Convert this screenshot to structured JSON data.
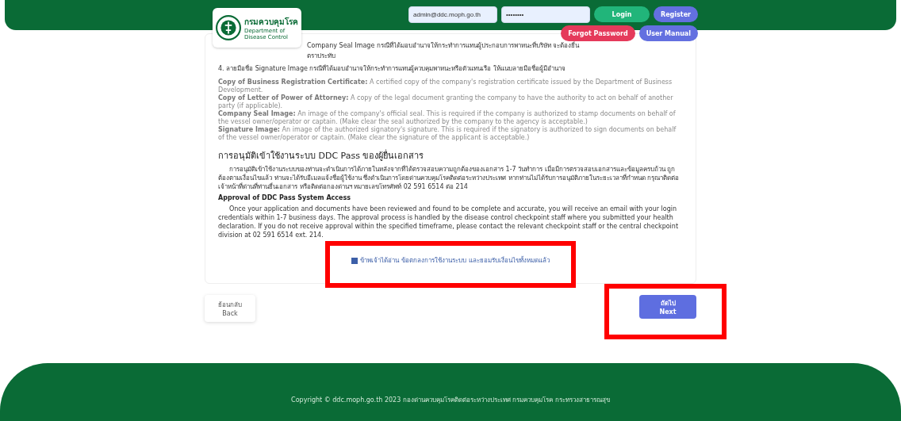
{
  "header": {
    "logo_title": "กรมควบคุมโรค",
    "logo_subtitle": "Department of Disease Control",
    "email": {
      "value": "admin@ddc.moph.go.th"
    },
    "password": {
      "value": "••••••••"
    },
    "buttons": [
      {
        "kind": "login",
        "label": "Login"
      },
      {
        "kind": "register",
        "label": "Register"
      },
      {
        "kind": "forgot",
        "label": "Forgot Password"
      },
      {
        "kind": "manual",
        "label": "User Manual"
      }
    ]
  },
  "documents": {
    "lines": [
      "Company Seal Image กรณีที่ได้มอบอำนาจให้กระทำการแทนผู้ประกอบการพาหนะที่บริษัท จะต้องยื่นตราประทับ",
      "4. ลายมือชื่อ Signature Image กรณีที่ได้มอบอำนาจให้กระทำการแทนผู้ควบคุมพาหนะหรือตัวแทนเรือ ให้แนบลายมือชื่อผู้มีอำนาจ"
    ],
    "definitions": [
      {
        "term": "Copy of Business Registration Certificate:",
        "text": "A certified copy of the company's registration certificate issued by the Department of Business Development."
      },
      {
        "term": "Copy of Letter of Power of Attorney:",
        "text": "A copy of the legal document granting the company to have the authority to act on behalf of another party (if applicable)."
      },
      {
        "term": "Company Seal Image:",
        "text": "An image of the company's official seal. This is required if the company is authorized to stamp documents on behalf of the vessel owner/operator or captain. (Make clear the seal authorized by the company to the agency is acceptable.)"
      },
      {
        "term": "Signature Image:",
        "text": "An image of the authorized signatory's signature. This is required if the signatory is authorized to sign documents on behalf of the vessel owner/operator or captain. (Make clear the signature of the applicant is acceptable.)"
      }
    ]
  },
  "approval": {
    "thai_heading": "การอนุมัติเข้าใช้งานระบบ DDC Pass ของผู้ยื่นเอกสาร",
    "thai_text": "การอนุมัติเข้าใช้งานระบบของท่านจะดำเนินการได้ภายในหลังจากที่ได้ตรวจสอบความถูกต้องของเอกสาร 1-7 วันทำการ เมื่อมีการตรวจสอบเอกสารและข้อมูลครบถ้วน ถูกต้องตามเงื่อนไขแล้ว ท่านจะได้รับอีเมลแจ้งชื่อผู้ใช้งาน ซึ่งดำเนินการโดยด่านควบคุมโรคติดต่อระหว่างประเทศ หากท่านไม่ได้รับการอนุมัติภายในระยะเวลาที่กำหนด กรุณาติดต่อเจ้าหน้าที่ด่านที่ท่านยื่นเอกสาร หรือติดต่อกองด่านฯ หมายเลขโทรศัพท์ 02 591 6514 ต่อ 214",
    "en_heading": "Approval of DDC Pass System Access",
    "en_text": "Once your application and documents have been reviewed and found to be complete and accurate, you will receive an email with your login credentials within 1-7 business days. The approval process is handled by the disease control checkpoint staff where you submitted your health declaration. If you do not receive approval within the specified timeframe, please contact the relevant checkpoint staff or the central checkpoint division at 02 591 6514 ext. 214."
  },
  "agreement": {
    "checked": true,
    "label": "ข้าพเจ้าได้อ่าน ข้อตกลงการใช้งานระบบ และยอมรับเงื่อนไขทั้งหมดแล้ว"
  },
  "nav": {
    "back": [
      "ย้อนกลับ",
      "Back"
    ],
    "next": [
      "ถัดไป",
      "Next"
    ]
  },
  "footer": {
    "copyright": "Copyright © ddc.moph.go.th 2023 กองด่านควบคุมโรคติดต่อระหว่างประเทศ กรมควบคุมโรค กระทรวงสาธารณสุข"
  }
}
